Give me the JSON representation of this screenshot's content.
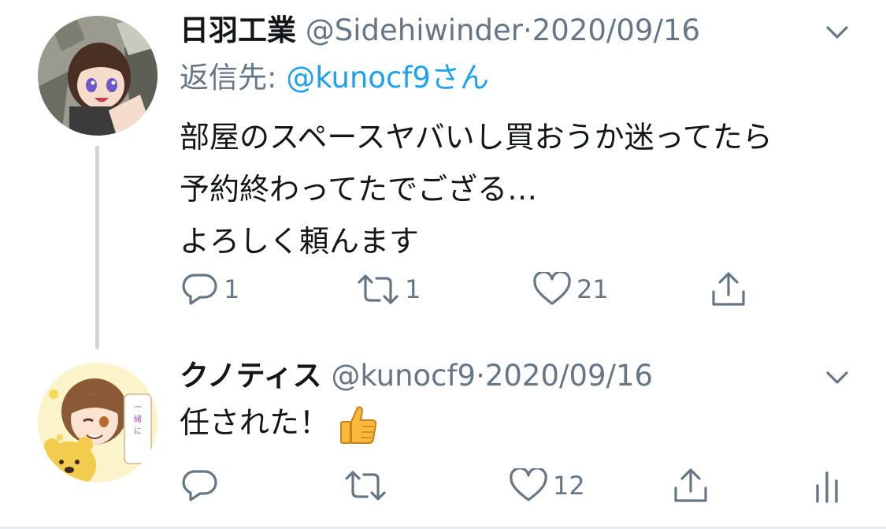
{
  "colors": {
    "text": "#14171a",
    "secondary": "#657786",
    "accent": "#1da1f2",
    "thread_line": "#cdd5dc"
  },
  "tweets": [
    {
      "display_name": "日羽工業",
      "handle": "@Sidehiwinder",
      "separator": "·",
      "date": "2020/09/16",
      "reply_label": "返信先:",
      "reply_user": "@kunocf9さん",
      "text_lines": [
        "部屋のスペースヤバいし買おうか迷ってたら",
        "予約終わってたでござる…",
        "よろしく頼んます"
      ],
      "actions": {
        "reply_icon": "reply-icon",
        "reply_count": "1",
        "retweet_icon": "retweet-icon",
        "retweet_count": "1",
        "like_icon": "heart-icon",
        "like_count": "21",
        "share_icon": "share-icon"
      }
    },
    {
      "display_name": "クノティス",
      "handle": "@kunocf9",
      "separator": "·",
      "date": "2020/09/16",
      "text": "任された！",
      "emoji": "thumbs-up-emoji",
      "actions": {
        "reply_icon": "reply-icon",
        "retweet_icon": "retweet-icon",
        "like_icon": "heart-icon",
        "like_count": "12",
        "share_icon": "share-icon",
        "stats_icon": "analytics-icon"
      }
    }
  ]
}
